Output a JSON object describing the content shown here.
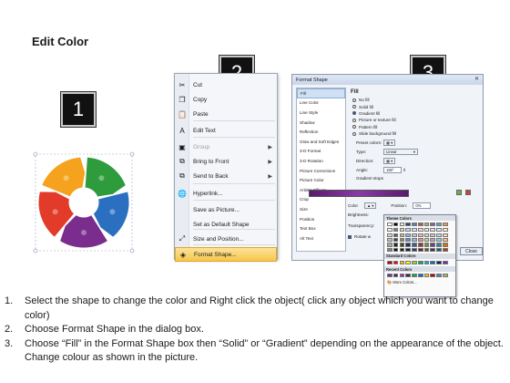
{
  "title": "Edit Color",
  "steps": {
    "one": "1",
    "two": "2",
    "three": "3"
  },
  "context_menu": {
    "items": [
      {
        "label": "Cut",
        "icon": "scissors-icon",
        "glyph": "✂",
        "disabled": false,
        "submenu": false
      },
      {
        "label": "Copy",
        "icon": "copy-icon",
        "glyph": "❐",
        "disabled": false,
        "submenu": false
      },
      {
        "label": "Paste",
        "icon": "paste-icon",
        "glyph": "📋",
        "disabled": false,
        "submenu": false
      },
      {
        "label": "Edit Text",
        "icon": "edit-text-icon",
        "glyph": "A",
        "disabled": false,
        "submenu": false
      },
      {
        "label": "Group",
        "icon": "group-icon",
        "glyph": "▣",
        "disabled": true,
        "submenu": true
      },
      {
        "label": "Bring to Front",
        "icon": "bring-front-icon",
        "glyph": "⧉",
        "disabled": false,
        "submenu": true
      },
      {
        "label": "Send to Back",
        "icon": "send-back-icon",
        "glyph": "⧉",
        "disabled": false,
        "submenu": true
      },
      {
        "label": "Hyperlink...",
        "icon": "hyperlink-icon",
        "glyph": "🌐",
        "disabled": false,
        "submenu": false
      },
      {
        "label": "Save as Picture...",
        "icon": "",
        "glyph": "",
        "disabled": false,
        "submenu": false
      },
      {
        "label": "Set as Default Shape",
        "icon": "",
        "glyph": "",
        "disabled": false,
        "submenu": false
      },
      {
        "label": "Size and Position...",
        "icon": "size-position-icon",
        "glyph": "⤢",
        "disabled": false,
        "submenu": false
      },
      {
        "label": "Format Shape...",
        "icon": "format-shape-icon",
        "glyph": "◈",
        "disabled": false,
        "submenu": false,
        "highlight": true
      }
    ]
  },
  "dialog": {
    "title": "Format Shape",
    "categories": [
      "Fill",
      "Line Color",
      "Line Style",
      "Shadow",
      "Reflection",
      "Glow and Soft Edges",
      "3-D Format",
      "3-D Rotation",
      "Picture Corrections",
      "Picture Color",
      "Artistic Effects",
      "Crop",
      "Size",
      "Position",
      "Text Box",
      "Alt Text"
    ],
    "selected_category": "Fill",
    "fill_heading": "Fill",
    "fill_options": [
      "No fill",
      "Solid fill",
      "Gradient fill",
      "Picture or texture fill",
      "Pattern fill",
      "Slide background fill"
    ],
    "fill_selected": "Gradient fill",
    "preset_colors_label": "Preset colors:",
    "type_label": "Type:",
    "type_value": "Linear",
    "direction_label": "Direction:",
    "angle_label": "Angle:",
    "angle_value": "180°",
    "gradient_stops_label": "Gradient stops",
    "color_label": "Color",
    "position_label": "Position:",
    "position_value": "0%",
    "brightness_label": "Brightness:",
    "transparency_label": "Transparency:",
    "rotate_label": "Rotate w",
    "close_label": "Close",
    "theme_colors_label": "Theme Colors",
    "standard_colors_label": "Standard Colors",
    "recent_colors_label": "Recent Colors",
    "more_colors_label": "More Colors..."
  },
  "palette": {
    "theme_top": [
      "#ffffff",
      "#000000",
      "#eeece1",
      "#1f497d",
      "#4f81bd",
      "#c0504d",
      "#9bbb59",
      "#8064a2",
      "#4bacc6",
      "#f79646"
    ],
    "theme_tints": [
      [
        "#f2f2f2",
        "#7f7f7f",
        "#ddd9c3",
        "#c6d9f0",
        "#dbe5f1",
        "#f2dcdb",
        "#ebf1dd",
        "#e5e0ec",
        "#dbeef3",
        "#fdeada"
      ],
      [
        "#d8d8d8",
        "#595959",
        "#c4bd97",
        "#8db3e2",
        "#b8cce4",
        "#e5b9b7",
        "#d7e3bc",
        "#ccc1d9",
        "#b7dde8",
        "#fbd5b5"
      ],
      [
        "#bfbfbf",
        "#3f3f3f",
        "#938953",
        "#548dd4",
        "#95b3d7",
        "#d99694",
        "#c3d69b",
        "#b2a2c7",
        "#92cddc",
        "#fac08f"
      ],
      [
        "#a5a5a5",
        "#262626",
        "#494429",
        "#17365d",
        "#366092",
        "#953734",
        "#76923c",
        "#5f497a",
        "#31859b",
        "#e36c09"
      ],
      [
        "#7f7f7f",
        "#0c0c0c",
        "#1d1b10",
        "#0f243e",
        "#244061",
        "#632423",
        "#4f6128",
        "#3f3151",
        "#205867",
        "#974806"
      ]
    ],
    "standard": [
      "#c00000",
      "#ff0000",
      "#ffc000",
      "#ffff00",
      "#92d050",
      "#00b050",
      "#00b0f0",
      "#0070c0",
      "#002060",
      "#7030a0"
    ],
    "recent": [
      "#7030a0",
      "#5a1a6e",
      "#8a3aa6",
      "#3f1f5f",
      "#00b050",
      "#0070c0",
      "#ffc000",
      "#c00000",
      "#4f81bd",
      "#9bbb59"
    ]
  },
  "pie_colors": [
    "#2e9b3c",
    "#2b6fc0",
    "#7a2d8c",
    "#e23b2a",
    "#f5a21e"
  ],
  "instructions": [
    {
      "num": "1.",
      "text": "Select the shape to change the color and Right click the object( click any object which you want to change color)"
    },
    {
      "num": "2.",
      "text": "Choose Format Shape in the dialog box."
    },
    {
      "num": "3.",
      "text": "Choose “Fill” in the Format Shape box then “Solid” or “Gradient” depending on the appearance of the object. Change colour as shown in the picture."
    }
  ]
}
